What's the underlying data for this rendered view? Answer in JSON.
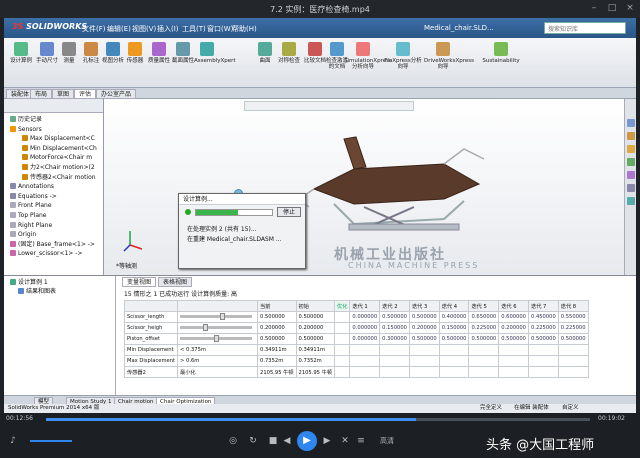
{
  "player": {
    "title": "7.2 实例：医疗检查椅.mp4",
    "time_elapsed": "00:12:56",
    "time_total": "00:19:02",
    "progress": 0.68,
    "volume": 0.7,
    "brand": "头条 @大国工程师",
    "quality": "高清"
  },
  "sw": {
    "logo_ds": "3S",
    "logo": "SOLIDWORKS",
    "menus": [
      "文件(F)",
      "编辑(E)",
      "视图(V)",
      "插入(I)",
      "工具(T)",
      "窗口(W)",
      "帮助(H)"
    ],
    "doc_title": "Medical_chair.SLD...",
    "search_placeholder": "搜索知识库",
    "ribbon": [
      {
        "label": "设计算例"
      },
      {
        "label": "手动尺寸"
      },
      {
        "label": "测量"
      },
      {
        "label": "孔标注"
      },
      {
        "label": "视图分析"
      },
      {
        "label": "传感器"
      },
      {
        "label": "质量属性"
      },
      {
        "label": "截面属性"
      },
      {
        "label": "AssemblyXpert"
      },
      {
        "label": "曲面"
      },
      {
        "label": "对称检查"
      },
      {
        "label": "比较文档"
      },
      {
        "label": "检查激活的文档"
      },
      {
        "label": "SimulationXpress分析向导"
      },
      {
        "label": "FloXpress分析向导"
      },
      {
        "label": "DriveWorksXpress向导"
      },
      {
        "label": "Sustainability"
      }
    ],
    "cm_tabs": [
      "装配体",
      "布局",
      "草图",
      "评估",
      "办公室产品"
    ],
    "tree": [
      {
        "label": "历史记录",
        "indent": 0,
        "color": "#6a8"
      },
      {
        "label": "Sensors",
        "indent": 0,
        "color": "#e90"
      },
      {
        "label": "Max Displacement<C",
        "indent": 1,
        "color": "#c80"
      },
      {
        "label": "Min Displacement<Ch",
        "indent": 1,
        "color": "#c80"
      },
      {
        "label": "MotorForce<Chair m",
        "indent": 1,
        "color": "#c80"
      },
      {
        "label": "力2<Chair motion>(2",
        "indent": 1,
        "color": "#c80"
      },
      {
        "label": "传感器2<Chair motion",
        "indent": 1,
        "color": "#c80"
      },
      {
        "label": "Annotations",
        "indent": 0,
        "color": "#88a"
      },
      {
        "label": "Equations ->",
        "indent": 0,
        "color": "#88a"
      },
      {
        "label": "Front Plane",
        "indent": 0,
        "color": "#aab"
      },
      {
        "label": "Top Plane",
        "indent": 0,
        "color": "#aab"
      },
      {
        "label": "Right Plane",
        "indent": 0,
        "color": "#aab"
      },
      {
        "label": "Origin",
        "indent": 0,
        "color": "#aab"
      },
      {
        "label": "(固定) Base_frame<1> ->",
        "indent": 0,
        "color": "#c6a"
      },
      {
        "label": "Lower_scissor<1> ->",
        "indent": 0,
        "color": "#c6a"
      }
    ],
    "view_label": "*等轴测",
    "watermark": "机械工业出版社",
    "watermark2": "CHINA MACHINE PRESS",
    "dialog": {
      "title": "设计算例...",
      "stop": "停止",
      "line1": "在处理实例 2 (共有 15)...",
      "line2": "在重建 Medical_chair.SLDASM ...",
      "progress": 0.55
    },
    "study_tree": {
      "root": "设计算例 1",
      "child": "结果和图表"
    },
    "opt_tabs": [
      "变量视图",
      "表格视图"
    ],
    "opt_status": "15 情形之 1 已成功运行 设计算例质量: 高",
    "table": {
      "headers": [
        "",
        "",
        "当前",
        "初始",
        "优化",
        "迭代 1",
        "迭代 2",
        "迭代 3",
        "迭代 4",
        "迭代 5",
        "迭代 6",
        "迭代 7",
        "迭代 8"
      ],
      "rows": [
        {
          "name": "Scissor_length",
          "cond": "",
          "slider": 0.6,
          "current": "0.500000",
          "initial": "0.500000",
          "opt": "",
          "iters": [
            "0.000000",
            "0.500000",
            "0.500000",
            "0.400000",
            "0.650000",
            "0.600000",
            "0.450000",
            "0.550000"
          ]
        },
        {
          "name": "Scissor_heigh",
          "cond": "",
          "slider": 0.35,
          "current": "0.200000",
          "initial": "0.200000",
          "opt": "",
          "iters": [
            "0.000000",
            "0.150000",
            "0.200000",
            "0.150000",
            "0.225000",
            "0.200000",
            "0.225000",
            "0.225000"
          ]
        },
        {
          "name": "Piston_offset",
          "cond": "",
          "slider": 0.5,
          "current": "0.500000",
          "initial": "0.500000",
          "opt": "",
          "iters": [
            "0.000000",
            "0.300000",
            "0.500000",
            "0.500000",
            "0.500000",
            "0.500000",
            "0.500000",
            "0.500000"
          ]
        },
        {
          "name": "Min Displacement",
          "cond": "< 0.375m",
          "slider": null,
          "current": "0.34911m",
          "initial": "0.34911m",
          "opt": "",
          "iters": [
            "",
            "",
            "",
            "",
            "",
            "",
            "",
            ""
          ]
        },
        {
          "name": "Max Displacement",
          "cond": "> 0.6m",
          "slider": null,
          "current": "0.7352m",
          "initial": "0.7352m",
          "opt": "",
          "iters": [
            "",
            "",
            "",
            "",
            "",
            "",
            "",
            ""
          ]
        },
        {
          "name": "传感器2",
          "cond": "最小化",
          "slider": null,
          "current": "2105.95 牛顿",
          "initial": "2105.95 牛顿",
          "opt": "",
          "iters": [
            "",
            "",
            "",
            "",
            "",
            "",
            "",
            ""
          ]
        }
      ]
    },
    "bottom_tabs": [
      "模型",
      "Motion Study 1",
      "Chair motion",
      "Chair Optimization"
    ],
    "status_left": "SolidWorks Premium 2014 x64 版",
    "status_right": [
      "完全定义",
      "在编辑 装配体",
      "自定义"
    ]
  }
}
